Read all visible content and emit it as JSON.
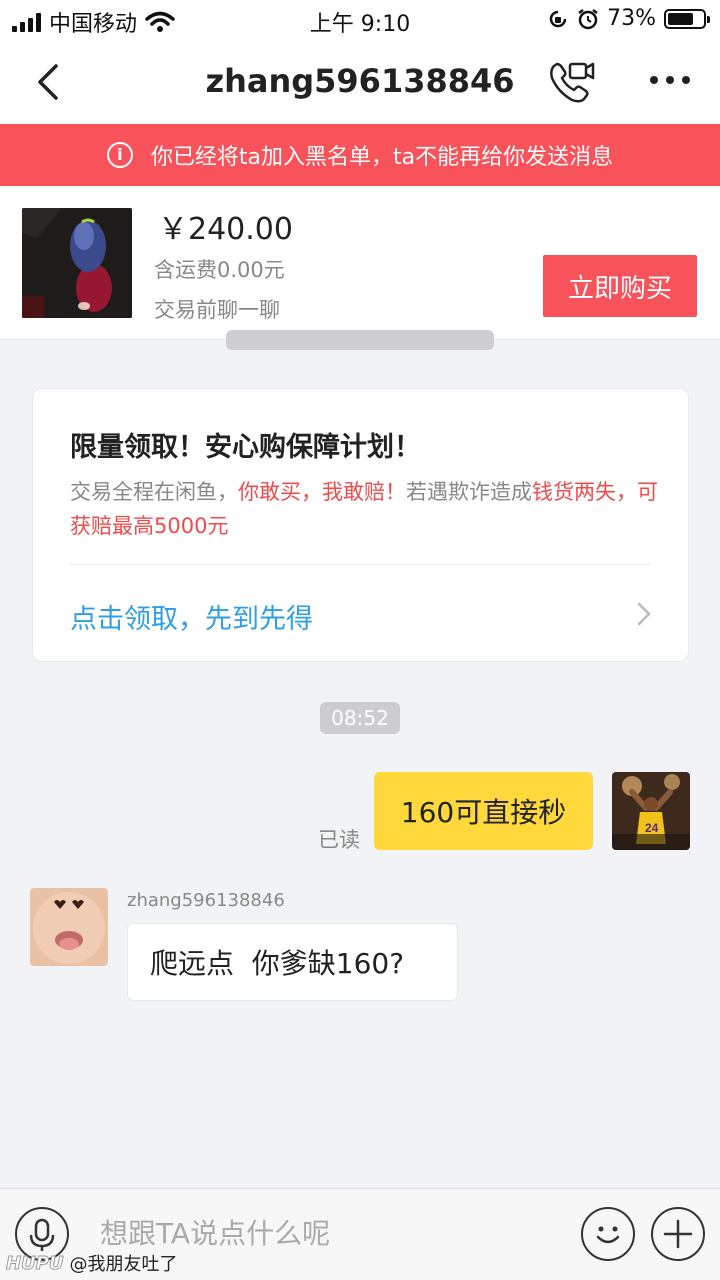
{
  "status_bar": {
    "carrier": "中国移动",
    "time": "上午 9:10",
    "battery": "73%"
  },
  "nav": {
    "title": "zhang596138846"
  },
  "banner": {
    "text": "你已经将ta加入黑名单，ta不能再给你发送消息"
  },
  "product": {
    "price": "￥240.00",
    "shipping": "含运费0.00元",
    "hint": "交易前聊一聊",
    "buy_label": "立即购买"
  },
  "promo": {
    "title": "限量领取！安心购保障计划！",
    "text_1": "交易全程在闲鱼，",
    "text_2": "你敢买，我敢赔！",
    "text_3": "若遇欺诈造成",
    "text_4": "钱货两失，可获赔最高5000元",
    "link": "点击领取，先到先得"
  },
  "messages": {
    "time": "08:52",
    "outgoing": {
      "read_status": "已读",
      "text": "160可直接秒"
    },
    "incoming": {
      "sender": "zhang596138846",
      "text": "爬远点  你爹缺160?"
    }
  },
  "input": {
    "placeholder": "想跟TA说点什么呢"
  },
  "watermark": {
    "brand": "HUPU",
    "handle": "@我朋友吐了"
  },
  "colors": {
    "accent_red": "#f8525a",
    "bubble_yellow": "#ffd93b",
    "link_blue": "#2f9ee8"
  }
}
